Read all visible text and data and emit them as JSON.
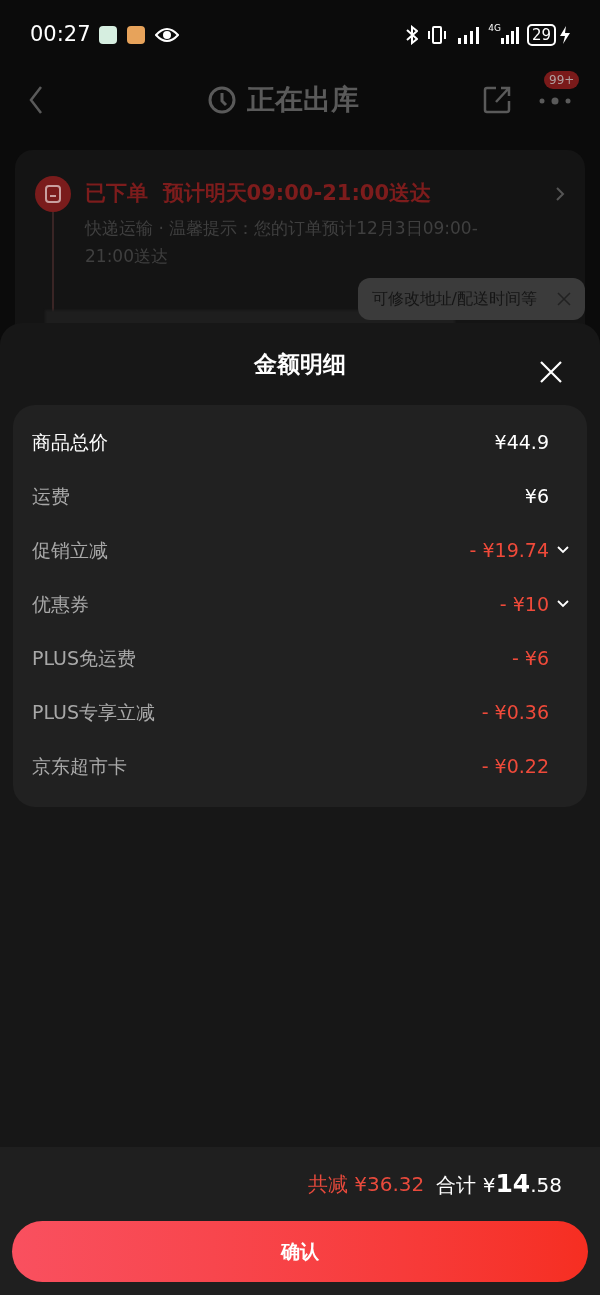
{
  "status_bar": {
    "time": "00:27",
    "network": "4G",
    "battery": "29"
  },
  "nav": {
    "title": "正在出库",
    "badge": "99+"
  },
  "order": {
    "headline": "已下单  预计明天09:00-21:00送达",
    "detail": "快递运输 · 温馨提示：您的订单预计12月3日09:00-21:00送达",
    "tooltip": "可修改地址/配送时间等"
  },
  "sheet": {
    "title": "金额明细",
    "rows": [
      {
        "label": "商品总价",
        "amount": "¥44.9",
        "kind": "total",
        "expandable": false
      },
      {
        "label": "运费",
        "amount": "¥6",
        "kind": "fee",
        "expandable": false
      },
      {
        "label": "促销立减",
        "amount": "- ¥19.74",
        "kind": "discount",
        "expandable": true
      },
      {
        "label": "优惠券",
        "amount": "- ¥10",
        "kind": "discount",
        "expandable": true
      },
      {
        "label": "PLUS免运费",
        "amount": "- ¥6",
        "kind": "discount",
        "expandable": false
      },
      {
        "label": "PLUS专享立减",
        "amount": "- ¥0.36",
        "kind": "discount",
        "expandable": false
      },
      {
        "label": "京东超市卡",
        "amount": "- ¥0.22",
        "kind": "discount",
        "expandable": false
      }
    ]
  },
  "footer": {
    "saving_label": "共减",
    "saving_value": "¥36.32",
    "total_label": "合计",
    "total_currency": "¥",
    "total_integer": "14",
    "total_decimal": ".58",
    "confirm": "确认"
  }
}
